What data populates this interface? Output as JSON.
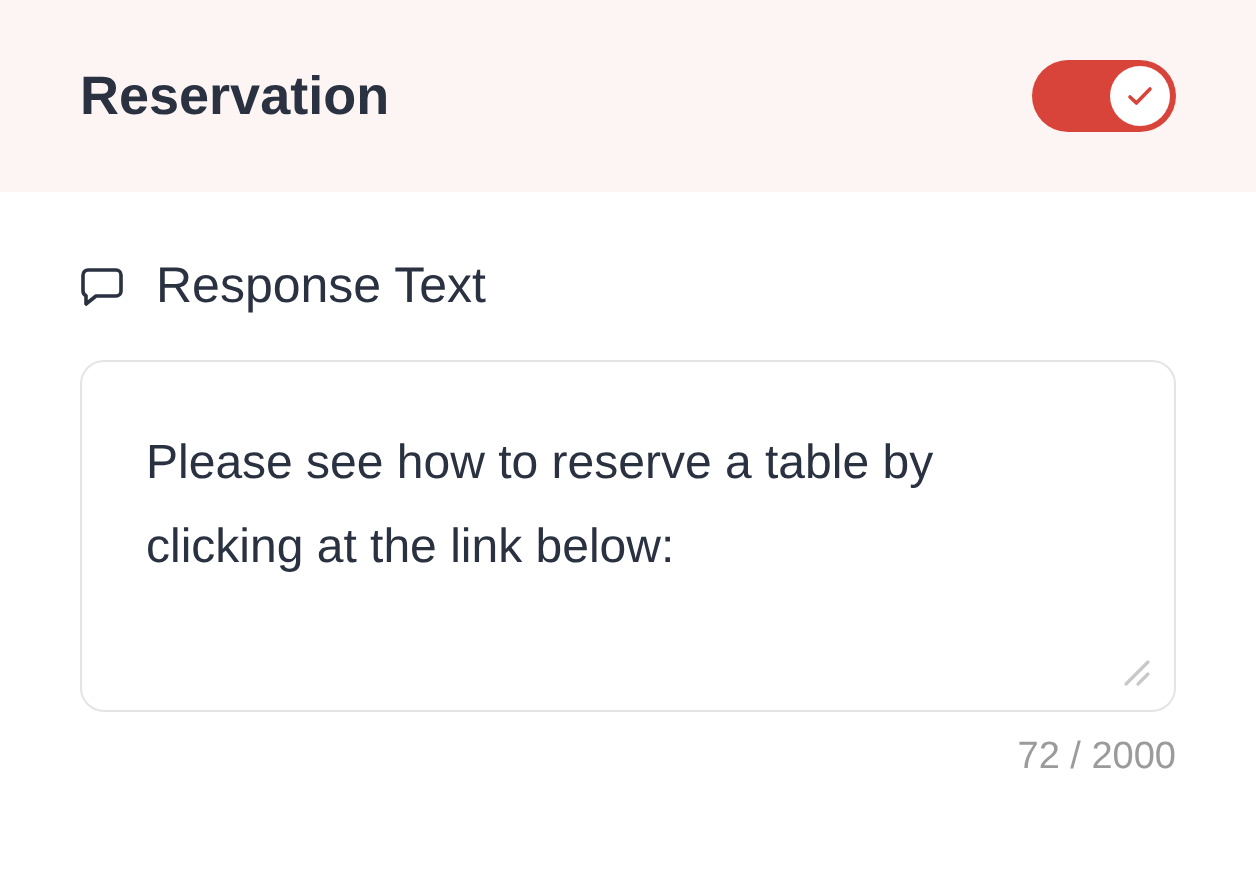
{
  "header": {
    "title": "Reservation",
    "toggle": {
      "on": true
    }
  },
  "response_field": {
    "label": "Response Text",
    "value": "Please see how to reserve a table by clicking at the link below:",
    "counter": "72 / 2000"
  }
}
